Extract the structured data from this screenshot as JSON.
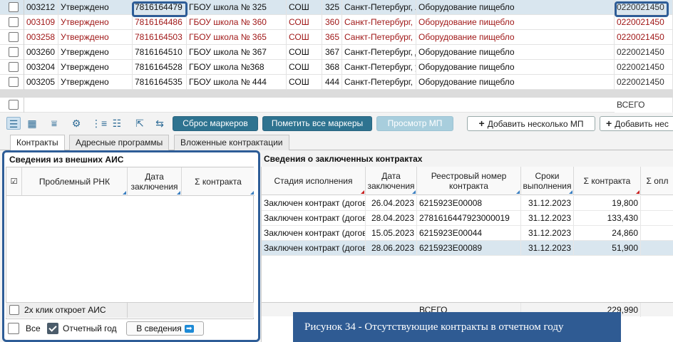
{
  "top_grid": {
    "rows": [
      {
        "id": "003212",
        "status": "Утверждено",
        "inn": "7816164479",
        "name": "ГБОУ школа № 325",
        "type": "СОШ",
        "num": "325",
        "address": "Санкт-Петербург, А",
        "equipment": "Оборудование пищебло",
        "code": "0220021450",
        "red": false,
        "selected": true
      },
      {
        "id": "003109",
        "status": "Утверждено",
        "inn": "7816164486",
        "name": "ГБОУ школа № 360",
        "type": "СОШ",
        "num": "360",
        "address": "Санкт-Петербург, В",
        "equipment": "Оборудование пищебло",
        "code": "0220021450",
        "red": true,
        "selected": false
      },
      {
        "id": "003258",
        "status": "Утверждено",
        "inn": "7816164503",
        "name": "ГБОУ школа № 365",
        "type": "СОШ",
        "num": "365",
        "address": "Санкт-Петербург, В",
        "equipment": "Оборудование пищебло",
        "code": "0220021450",
        "red": true,
        "selected": false
      },
      {
        "id": "003260",
        "status": "Утверждено",
        "inn": "7816164510",
        "name": "ГБОУ школа № 367",
        "type": "СОШ",
        "num": "367",
        "address": "Санкт-Петербург, Д",
        "equipment": "Оборудование пищебло",
        "code": "0220021450",
        "red": false,
        "selected": false
      },
      {
        "id": "003204",
        "status": "Утверждено",
        "inn": "7816164528",
        "name": "ГБОУ школа №368",
        "type": "СОШ",
        "num": "368",
        "address": "Санкт-Петербург, у",
        "equipment": "Оборудование пищебло",
        "code": "0220021450",
        "red": false,
        "selected": false
      },
      {
        "id": "003205",
        "status": "Утверждено",
        "inn": "7816164535",
        "name": "ГБОУ школа № 444",
        "type": "СОШ",
        "num": "444",
        "address": "Санкт-Петербург, К",
        "equipment": "Оборудование пищебло",
        "code": "0220021450",
        "red": false,
        "selected": false
      }
    ],
    "total_label": "ВСЕГО"
  },
  "toolbar": {
    "reset_markers": "Сброс маркеров",
    "mark_all": "Пометить все маркеры",
    "view_mp": "Просмотр МП",
    "add_several": "Добавить несколько МП",
    "add_cut": "Добавить нес"
  },
  "tabs": [
    "Контракты",
    "Адресные программы",
    "Вложенные контрактации"
  ],
  "left_panel": {
    "title": "Сведения из внешних АИС",
    "columns": [
      "Проблемный РНК",
      "Дата заключения",
      "Σ контракта"
    ],
    "footer_hint": "2х клик откроет АИС",
    "all_label": "Все",
    "report_year_label": "Отчетный год",
    "to_info_button": "В сведения",
    "arrow_glyph": "➡"
  },
  "right_panel": {
    "title": "Сведения о заключенных контрактах",
    "columns": [
      "Стадия исполнения",
      "Дата заключения",
      "Реестровый номер контракта",
      "Сроки выполнения",
      "Σ контракта",
      "Σ опл"
    ],
    "rows": [
      {
        "stage": "Заключен контракт (догов",
        "date": "26.04.2023",
        "reg_no": "6215923E00008",
        "term": "31.12.2023",
        "sum": "19,800",
        "selected": false
      },
      {
        "stage": "Заключен контракт (догов",
        "date": "28.04.2023",
        "reg_no": "2781616447923000019",
        "term": "31.12.2023",
        "sum": "133,430",
        "selected": false
      },
      {
        "stage": "Заключен контракт (догов",
        "date": "15.05.2023",
        "reg_no": "6215923E00044",
        "term": "31.12.2023",
        "sum": "24,860",
        "selected": false
      },
      {
        "stage": "Заключен контракт (догов",
        "date": "28.06.2023",
        "reg_no": "6215923E00089",
        "term": "31.12.2023",
        "sum": "51,900",
        "selected": true
      }
    ],
    "total_label": "ВСЕГО",
    "total_sum": "229,990"
  },
  "caption": "Рисунок 34 - Отсутствующие контракты в отчетном году",
  "colors": {
    "accent": "#2e7390",
    "highlight_border": "#2e5d97",
    "error_text": "#a01818",
    "selection": "#d9e6ef"
  }
}
